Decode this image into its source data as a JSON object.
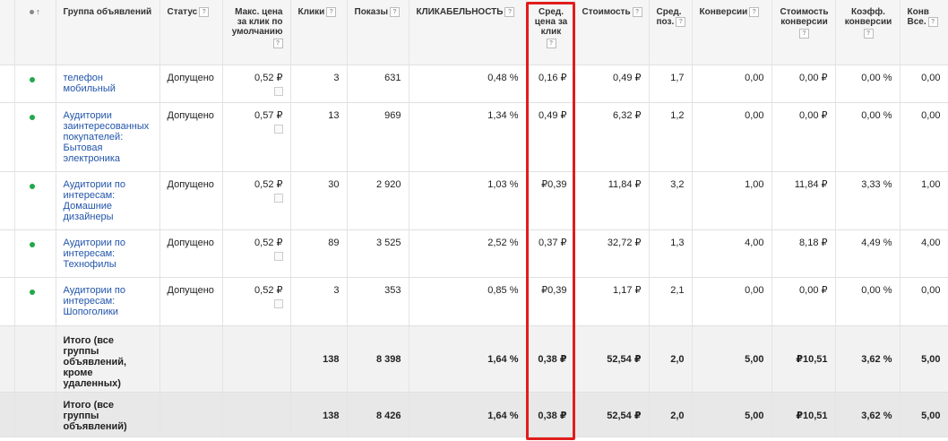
{
  "columns": {
    "group": "Группа объявлений",
    "status": "Статус",
    "max_cpc": "Макс. цена за клик по умолчанию",
    "clicks": "Клики",
    "impressions": "Показы",
    "ctr": "КЛИКАБЕЛЬНОСТЬ",
    "avg_cpc": "Сред. цена за клик",
    "cost": "Стоимость",
    "avg_pos": "Сред. поз.",
    "conversions": "Конверсии",
    "cost_conv": "Стоимость конверсии",
    "conv_rate": "Коэфф. конверсии",
    "conv_all": "Конв Все."
  },
  "help_glyph": "?",
  "sort_glyph": "↑",
  "rows": [
    {
      "group": "телефон мобильный",
      "status": "Допущено",
      "max_cpc": "0,52 ₽",
      "clicks": "3",
      "impressions": "631",
      "ctr": "0,48 %",
      "avg_cpc": "0,16 ₽",
      "cost": "0,49 ₽",
      "avg_pos": "1,7",
      "conversions": "0,00",
      "cost_conv": "0,00 ₽",
      "conv_rate": "0,00 %",
      "conv_all": "0,00"
    },
    {
      "group": "Аудитории заинтересованных покупателей: Бытовая электроника",
      "status": "Допущено",
      "max_cpc": "0,57 ₽",
      "clicks": "13",
      "impressions": "969",
      "ctr": "1,34 %",
      "avg_cpc": "0,49 ₽",
      "cost": "6,32 ₽",
      "avg_pos": "1,2",
      "conversions": "0,00",
      "cost_conv": "0,00 ₽",
      "conv_rate": "0,00 %",
      "conv_all": "0,00"
    },
    {
      "group": "Аудитории по интересам: Домашние дизайнеры",
      "status": "Допущено",
      "max_cpc": "0,52 ₽",
      "clicks": "30",
      "impressions": "2 920",
      "ctr": "1,03 %",
      "avg_cpc": "₽0,39",
      "cost": "11,84 ₽",
      "avg_pos": "3,2",
      "conversions": "1,00",
      "cost_conv": "11,84 ₽",
      "conv_rate": "3,33 %",
      "conv_all": "1,00"
    },
    {
      "group": "Аудитории по интересам: Технофилы",
      "status": "Допущено",
      "max_cpc": "0,52 ₽",
      "clicks": "89",
      "impressions": "3 525",
      "ctr": "2,52 %",
      "avg_cpc": "0,37 ₽",
      "cost": "32,72 ₽",
      "avg_pos": "1,3",
      "conversions": "4,00",
      "cost_conv": "8,18 ₽",
      "conv_rate": "4,49 %",
      "conv_all": "4,00"
    },
    {
      "group": "Аудитории по интересам: Шопоголики",
      "status": "Допущено",
      "max_cpc": "0,52 ₽",
      "clicks": "3",
      "impressions": "353",
      "ctr": "0,85 %",
      "avg_cpc": "₽0,39",
      "cost": "1,17 ₽",
      "avg_pos": "2,1",
      "conversions": "0,00",
      "cost_conv": "0,00 ₽",
      "conv_rate": "0,00 %",
      "conv_all": "0,00"
    }
  ],
  "totals": [
    {
      "group": "Итого (все группы объявлений, кроме удаленных)",
      "clicks": "138",
      "impressions": "8 398",
      "ctr": "1,64 %",
      "avg_cpc": "0,38 ₽",
      "cost": "52,54 ₽",
      "avg_pos": "2,0",
      "conversions": "5,00",
      "cost_conv": "₽10,51",
      "conv_rate": "3,62 %",
      "conv_all": "5,00"
    },
    {
      "group": "Итого (все группы объявлений)",
      "clicks": "138",
      "impressions": "8 426",
      "ctr": "1,64 %",
      "avg_cpc": "0,38 ₽",
      "cost": "52,54 ₽",
      "avg_pos": "2,0",
      "conversions": "5,00",
      "cost_conv": "₽10,51",
      "conv_rate": "3,62 %",
      "conv_all": "5,00"
    }
  ],
  "colors": {
    "highlight": "#e11d1d",
    "link": "#2255aa",
    "status_dot": "#21a84a"
  }
}
